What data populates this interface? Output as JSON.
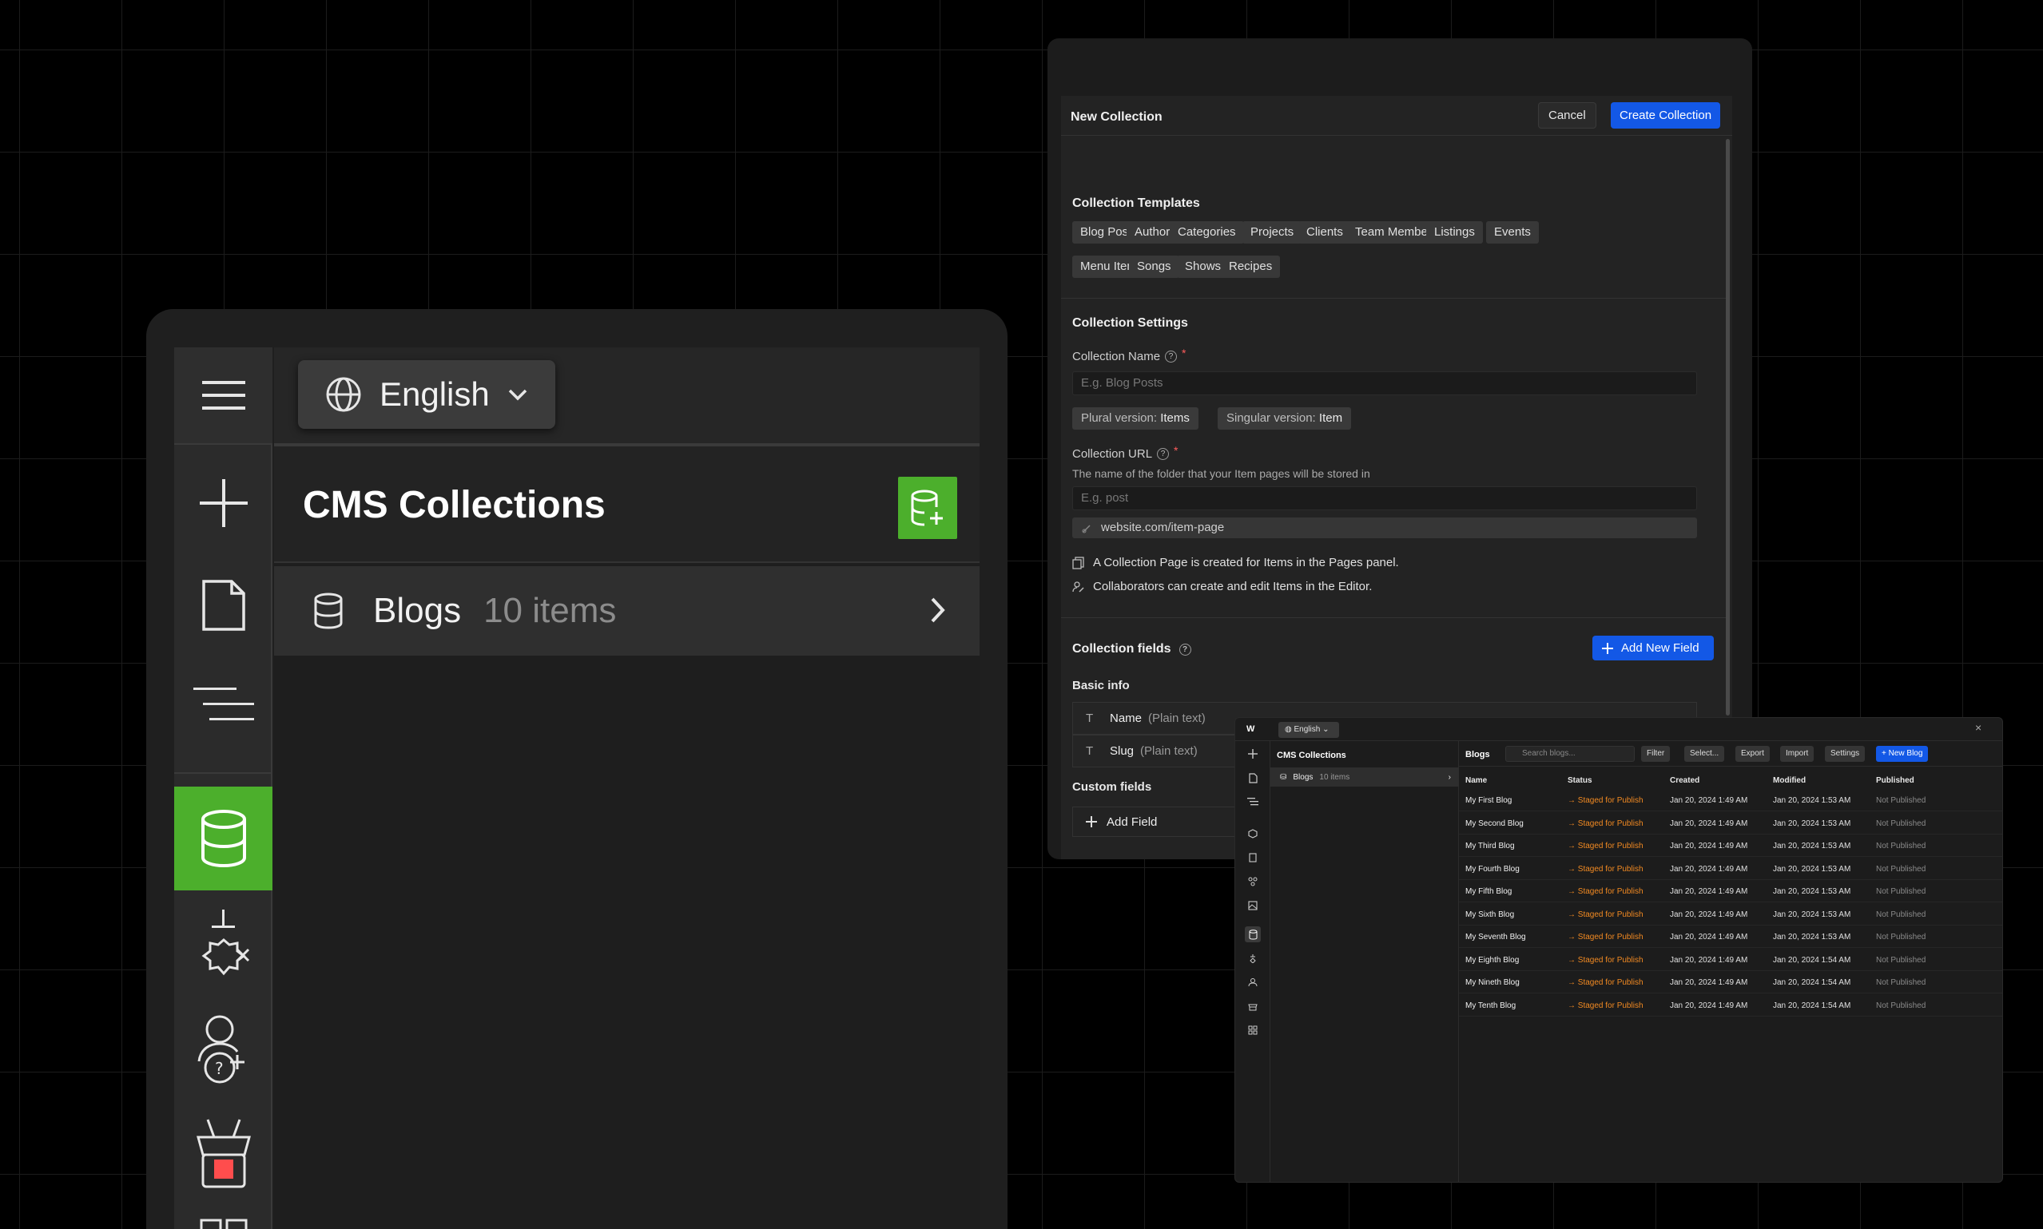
{
  "colors": {
    "accent_green": "#4caf2c",
    "accent_blue": "#1358e6",
    "status_orange": "#f28a22"
  },
  "left": {
    "language": "English",
    "title": "CMS Collections",
    "collection": {
      "name": "Blogs",
      "count": "10 items"
    },
    "rail_icons": [
      "menu-icon",
      "plus-icon",
      "page-icon",
      "navigator-icon",
      "database-icon",
      "components-icon",
      "users-icon",
      "ecommerce-icon",
      "apps-icon"
    ]
  },
  "modal": {
    "title": "New Collection",
    "cancel": "Cancel",
    "create": "Create Collection",
    "templates_title": "Collection Templates",
    "templates_row1": [
      "Blog Posts",
      "Authors",
      "Categories",
      "Projects",
      "Clients",
      "Team Members",
      "Listings",
      "Events"
    ],
    "templates_row2": [
      "Menu Items",
      "Songs",
      "Shows",
      "Recipes"
    ],
    "settings_title": "Collection Settings",
    "name_label": "Collection Name",
    "name_placeholder": "E.g. Blog Posts",
    "plural_label": "Plural version:",
    "plural_value": "Items",
    "singular_label": "Singular version:",
    "singular_value": "Item",
    "url_label": "Collection URL",
    "url_hint": "The name of the folder that your Item pages will be stored in",
    "url_placeholder": "E.g. post",
    "url_preview": "website.com/item-page",
    "info1": "A Collection Page is created for Items in the Pages panel.",
    "info2": "Collaborators can create and edit Items in the Editor.",
    "fields_title": "Collection fields",
    "add_new_field": "Add New Field",
    "basic_info": "Basic info",
    "fields": [
      {
        "name": "Name",
        "type": "(Plain text)"
      },
      {
        "name": "Slug",
        "type": "(Plain text)"
      }
    ],
    "custom_fields": "Custom fields",
    "add_field": "Add Field"
  },
  "mini": {
    "language": "English",
    "collections_title": "CMS Collections",
    "collection_name": "Blogs",
    "collection_count": "10 items",
    "main_title": "Blogs",
    "search_placeholder": "Search blogs...",
    "filter": "Filter",
    "select": "Select...",
    "export": "Export",
    "import": "Import",
    "settings": "Settings",
    "new_blog": "+ New Blog",
    "columns": [
      "Name",
      "Status",
      "Created",
      "Modified",
      "Published"
    ],
    "rows": [
      {
        "name": "My First Blog",
        "status": "Staged for Publish",
        "created": "Jan 20, 2024 1:49 AM",
        "modified": "Jan 20, 2024 1:53 AM",
        "published": "Not Published"
      },
      {
        "name": "My Second Blog",
        "status": "Staged for Publish",
        "created": "Jan 20, 2024 1:49 AM",
        "modified": "Jan 20, 2024 1:53 AM",
        "published": "Not Published"
      },
      {
        "name": "My Third Blog",
        "status": "Staged for Publish",
        "created": "Jan 20, 2024 1:49 AM",
        "modified": "Jan 20, 2024 1:53 AM",
        "published": "Not Published"
      },
      {
        "name": "My Fourth Blog",
        "status": "Staged for Publish",
        "created": "Jan 20, 2024 1:49 AM",
        "modified": "Jan 20, 2024 1:53 AM",
        "published": "Not Published"
      },
      {
        "name": "My Fifth Blog",
        "status": "Staged for Publish",
        "created": "Jan 20, 2024 1:49 AM",
        "modified": "Jan 20, 2024 1:53 AM",
        "published": "Not Published"
      },
      {
        "name": "My Sixth Blog",
        "status": "Staged for Publish",
        "created": "Jan 20, 2024 1:49 AM",
        "modified": "Jan 20, 2024 1:53 AM",
        "published": "Not Published"
      },
      {
        "name": "My Seventh Blog",
        "status": "Staged for Publish",
        "created": "Jan 20, 2024 1:49 AM",
        "modified": "Jan 20, 2024 1:53 AM",
        "published": "Not Published"
      },
      {
        "name": "My Eighth Blog",
        "status": "Staged for Publish",
        "created": "Jan 20, 2024 1:49 AM",
        "modified": "Jan 20, 2024 1:54 AM",
        "published": "Not Published"
      },
      {
        "name": "My Nineth Blog",
        "status": "Staged for Publish",
        "created": "Jan 20, 2024 1:49 AM",
        "modified": "Jan 20, 2024 1:54 AM",
        "published": "Not Published"
      },
      {
        "name": "My Tenth Blog",
        "status": "Staged for Publish",
        "created": "Jan 20, 2024 1:49 AM",
        "modified": "Jan 20, 2024 1:54 AM",
        "published": "Not Published"
      }
    ]
  }
}
